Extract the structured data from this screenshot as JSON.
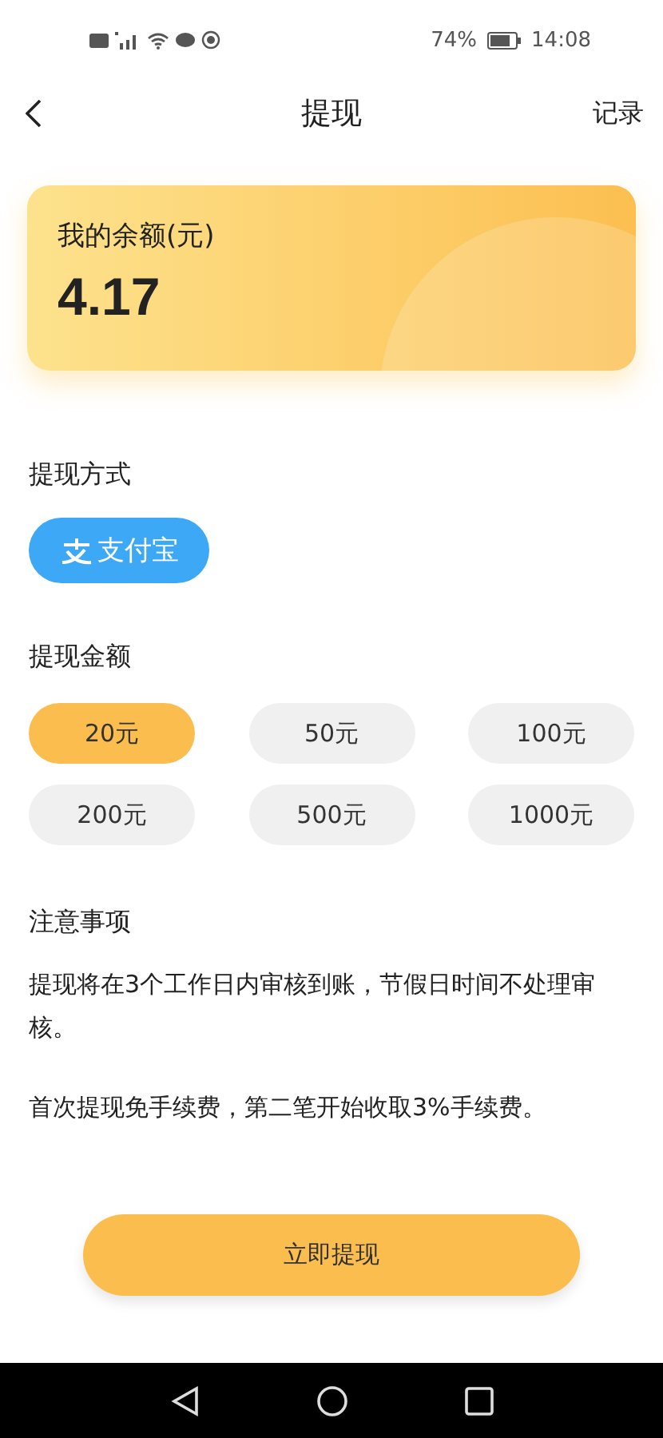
{
  "status_bar": {
    "battery_percent": "74%",
    "time": "14:08"
  },
  "nav": {
    "title": "提现",
    "action": "记录"
  },
  "balance": {
    "label": "我的余额(元)",
    "amount": "4.17"
  },
  "method": {
    "title": "提现方式",
    "option": "支付宝"
  },
  "amount": {
    "title": "提现金额",
    "options": [
      {
        "label": "20元",
        "selected": true
      },
      {
        "label": "50元",
        "selected": false
      },
      {
        "label": "100元",
        "selected": false
      },
      {
        "label": "200元",
        "selected": false
      },
      {
        "label": "500元",
        "selected": false
      },
      {
        "label": "1000元",
        "selected": false
      }
    ]
  },
  "notes": {
    "title": "注意事项",
    "paragraphs": [
      "提现将在3个工作日内审核到账，节假日时间不处理审核。",
      "首次提现免手续费，第二笔开始收取3%手续费。"
    ]
  },
  "submit": "立即提现"
}
